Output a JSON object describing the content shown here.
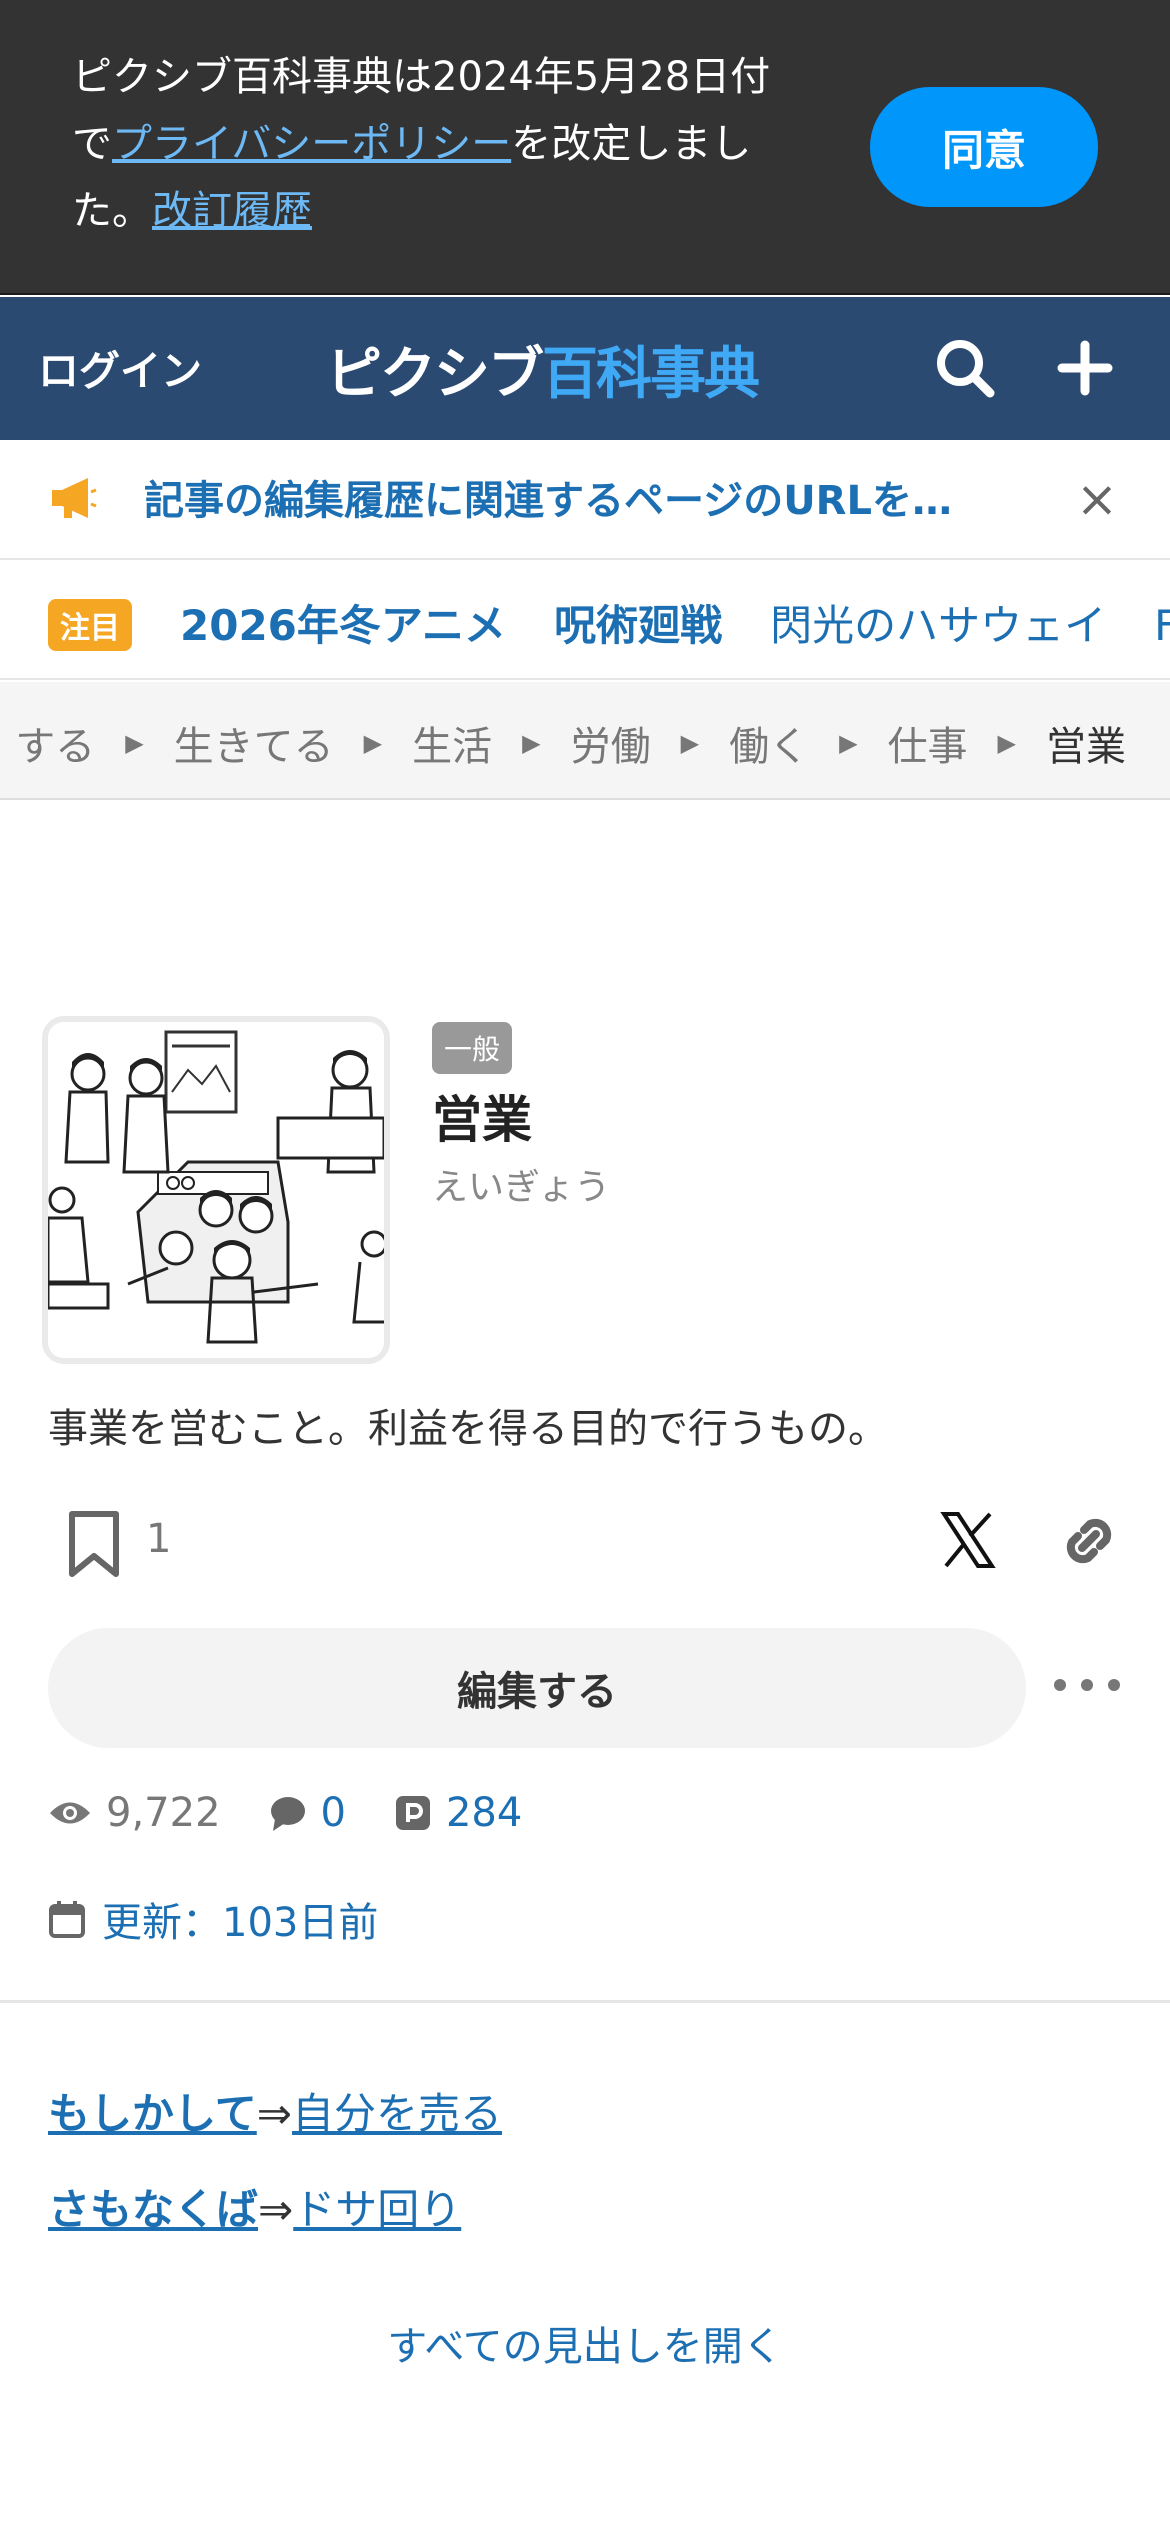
{
  "consent": {
    "text_line1": "ピクシブ百科事典は2024年5月28日付",
    "text_line2_pre": "で",
    "policy_link": "プライバシーポリシー",
    "text_line2_post": "を改定しまし",
    "text_line3_pre": "た。",
    "history_link": "改訂履歴",
    "agree_label": "同意"
  },
  "header": {
    "login_label": "ログイン",
    "logo_part1": "ピクシブ",
    "logo_part2": "百科事典"
  },
  "notice": {
    "text": "記事の編集履歴に関連するページのURLを…",
    "close_label": "×"
  },
  "trending": {
    "badge": "注目",
    "items": [
      "2026年冬アニメ",
      "呪術廻戦",
      "閃光のハサウェイ",
      "F"
    ]
  },
  "breadcrumb": {
    "items": [
      "する",
      "生きてる",
      "生活",
      "労働",
      "働く",
      "仕事"
    ],
    "current": "営業",
    "separator": "▶"
  },
  "article": {
    "category": "一般",
    "title": "営業",
    "reading": "えいぎょう",
    "summary": "事業を営むこと。利益を得る目的で行うもの。",
    "bookmark_count": "1",
    "edit_label": "編集する",
    "views": "9,722",
    "comments": "0",
    "pixiv_count": "284",
    "updated": "更新：103日前"
  },
  "refs": [
    {
      "key": "もしかして",
      "arrow": "⇒",
      "value": "自分を売る"
    },
    {
      "key": "さもなくば",
      "arrow": "⇒",
      "value": "ドサ回り"
    }
  ],
  "open_all_label": "すべての見出しを開く",
  "colors": {
    "header_bg": "#2b4a72",
    "link": "#1c6fb2",
    "agree_button": "#0096fa",
    "badge": "#f5a623",
    "consent_bg": "#333333"
  },
  "icons": [
    "search-icon",
    "plus-icon",
    "megaphone-icon",
    "close-icon",
    "bookmark-icon",
    "x-logo-icon",
    "link-icon",
    "more-icon",
    "eye-icon",
    "comment-icon",
    "pixiv-icon",
    "calendar-icon"
  ]
}
